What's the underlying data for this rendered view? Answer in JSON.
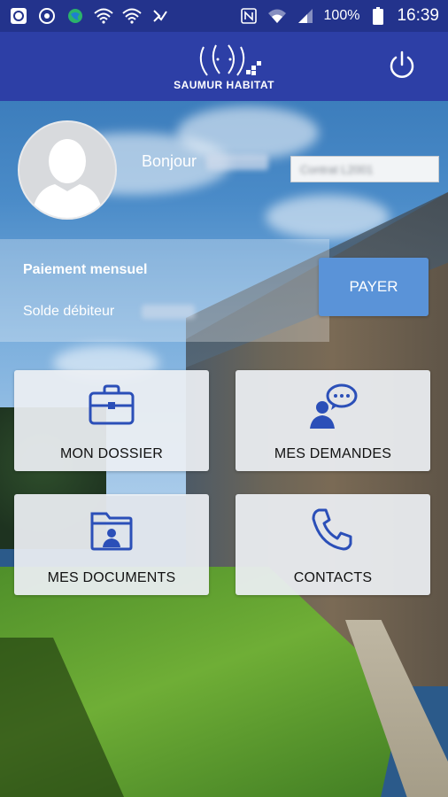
{
  "status_bar": {
    "battery": "100%",
    "time": "16:39"
  },
  "app_bar": {
    "logo_text": "SAUMUR HABITAT"
  },
  "profile": {
    "greeting": "Bonjour",
    "contract_placeholder": "Contrat L2001"
  },
  "payment": {
    "title": "Paiement mensuel",
    "subtitle": "Solde débiteur",
    "button_label": "PAYER"
  },
  "tiles": [
    {
      "label": "MON DOSSIER",
      "icon": "briefcase-icon"
    },
    {
      "label": "MES DEMANDES",
      "icon": "user-chat-icon"
    },
    {
      "label": "MES DOCUMENTS",
      "icon": "folder-user-icon"
    },
    {
      "label": "CONTACTS",
      "icon": "phone-icon"
    }
  ],
  "colors": {
    "status_bar": "#23338c",
    "app_bar": "#2d3fa6",
    "pay_button": "#5a93d8",
    "icon_blue": "#2b4fb8"
  }
}
